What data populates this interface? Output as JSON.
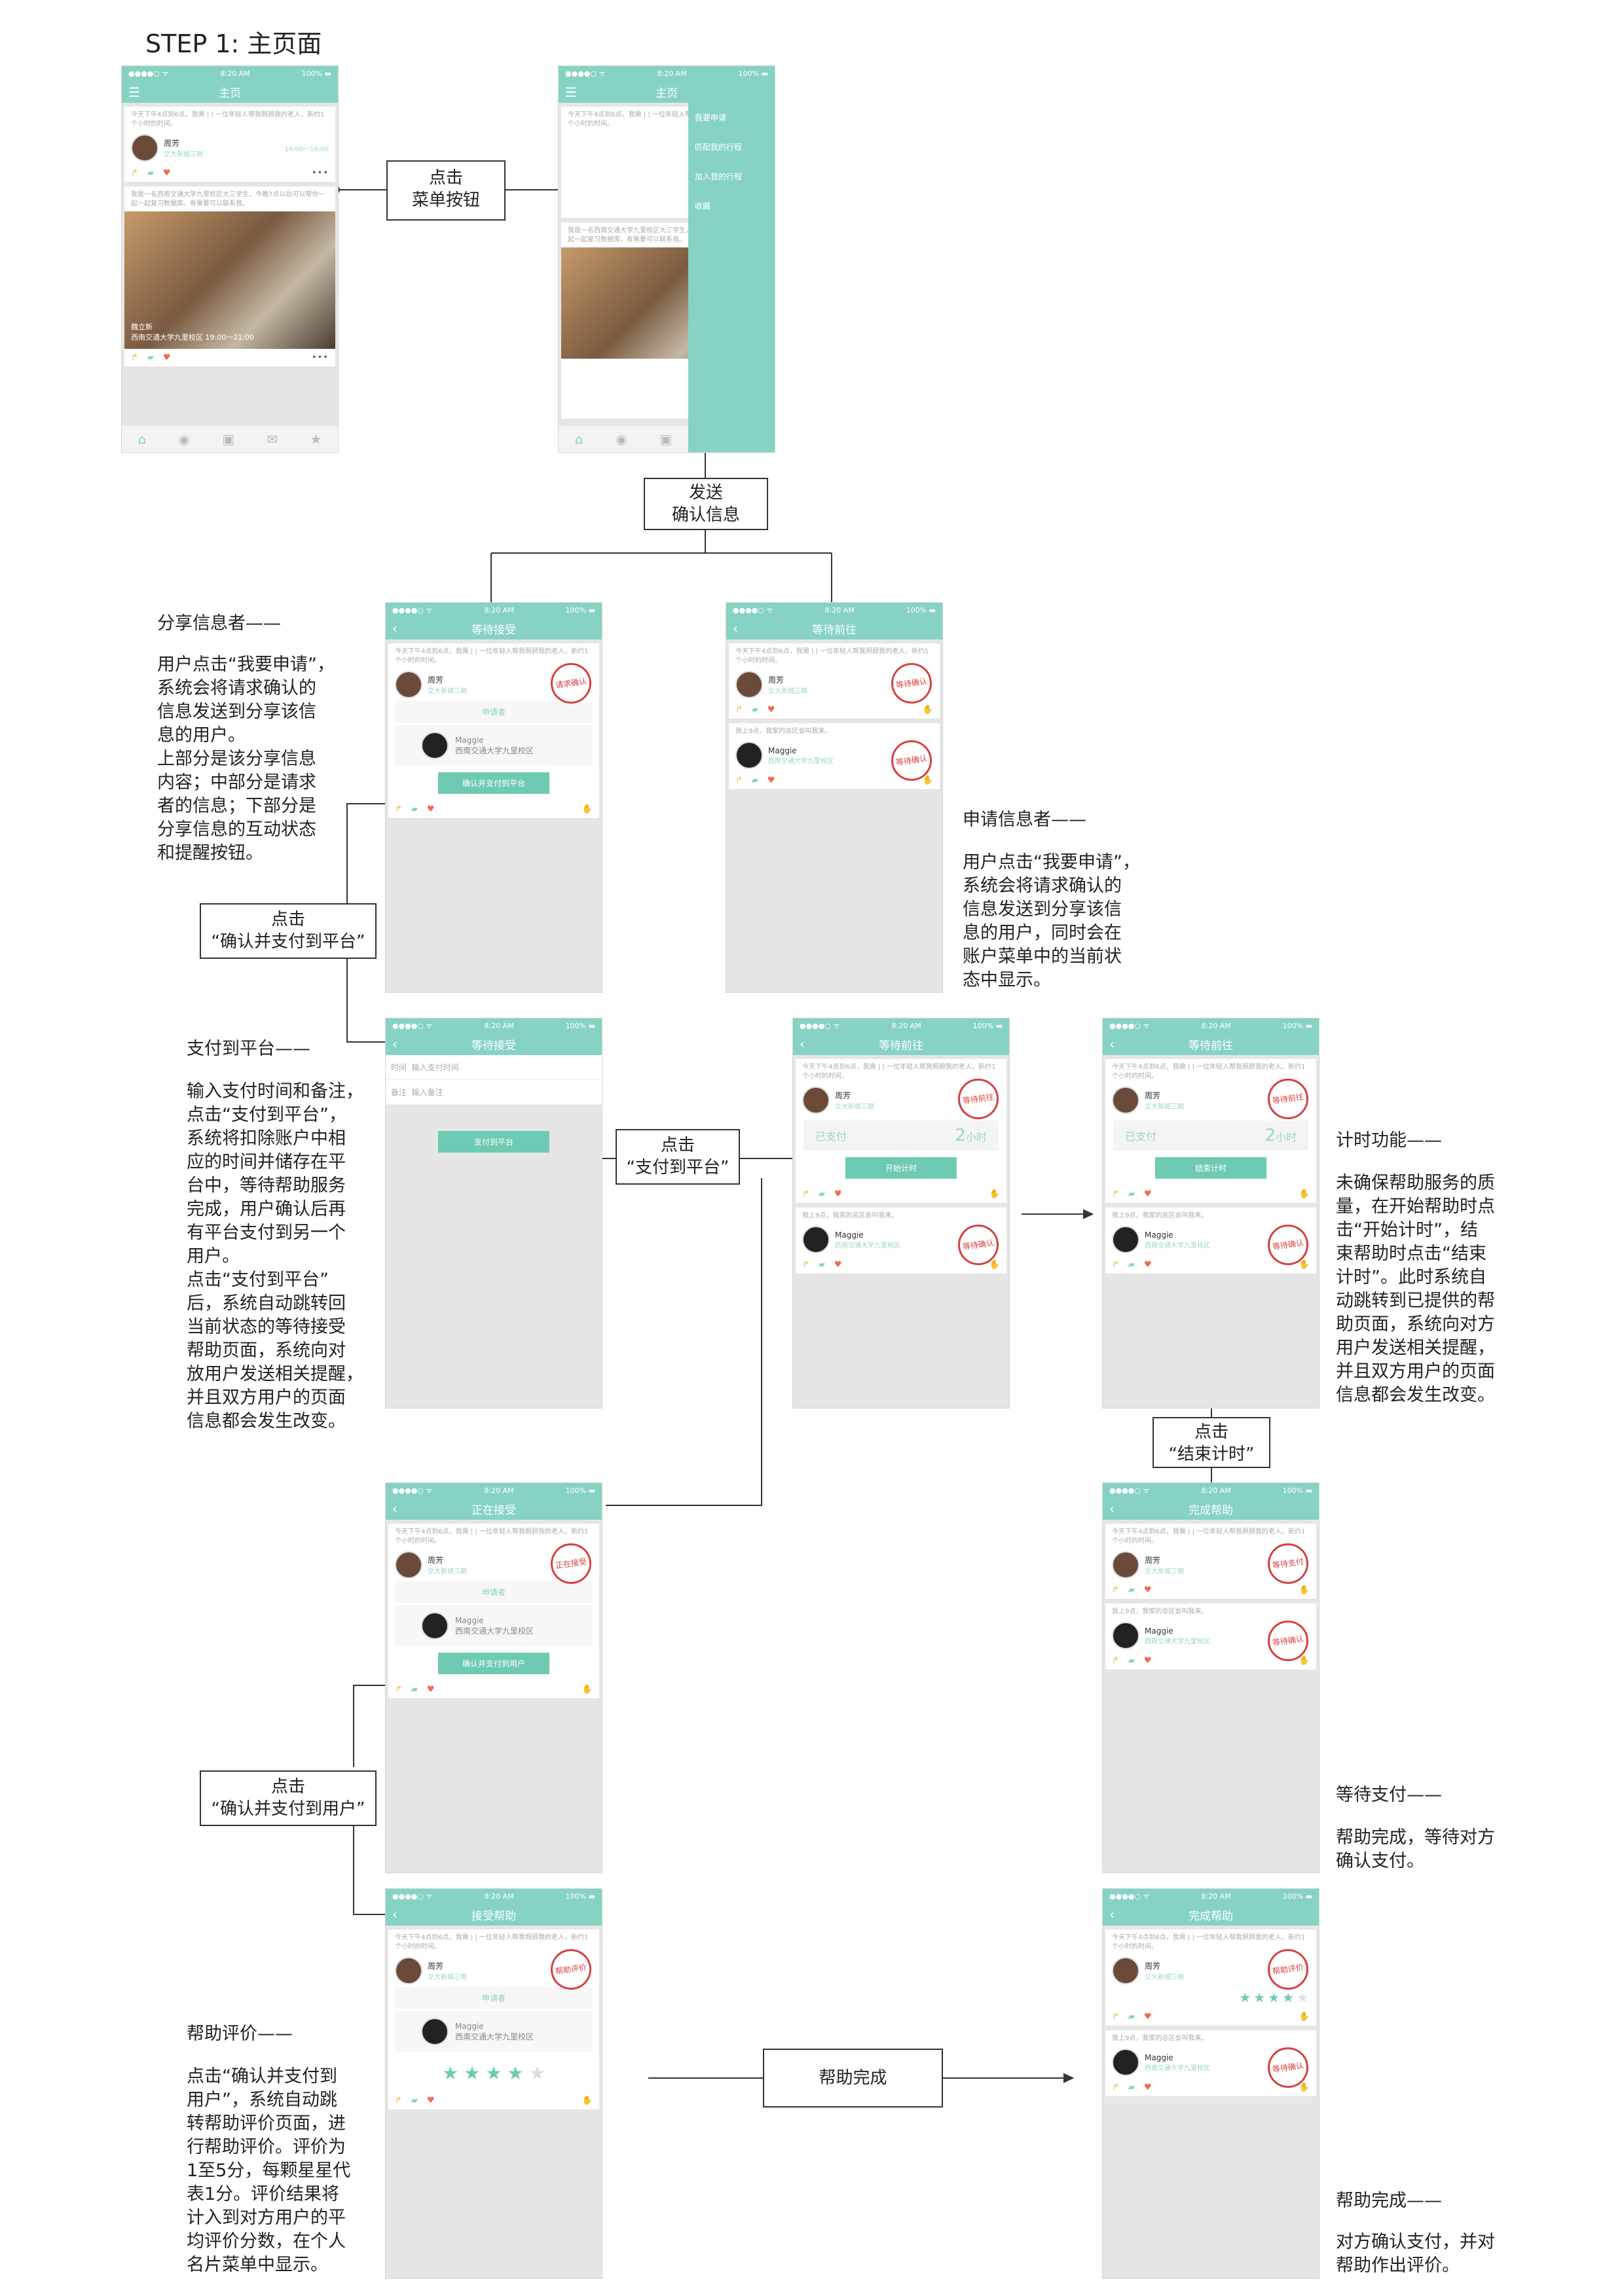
{
  "step_title": "STEP 1: 主页面",
  "status_bar": {
    "signal": "●●●●○ ᯤ",
    "time": "8:20 AM",
    "battery": "100% ▬"
  },
  "home_screen": {
    "nav_title": "主页",
    "post1_text": "今天下午4点到6点，我需 | | 一位年轻人帮我照顾我的老人，新约1个小时的时间。",
    "post1_user": "周芳",
    "post1_loc": "交大新城三期",
    "post1_time": "14:00一16:00",
    "post2_text": "我是一名西南交通大学九里校区大三学生，今晚7点以后可以帮你一起一起复习数据库。有需要可以联系我。",
    "post2_user": "魏立新",
    "post2_loc": "西南交通大学九里校区",
    "post2_time": "19:00一21:00",
    "counts": [
      "4",
      "2",
      "7",
      "2",
      "2",
      "6"
    ]
  },
  "menu_screen": {
    "nav_title": "主页",
    "menu_items": [
      "我要申请",
      "匹配我的行程",
      "加入我的行程",
      "收藏"
    ]
  },
  "screens": {
    "wait_accept": "等待接受",
    "wait_go": "等待前往",
    "accepting": "正在接受",
    "accept_help": "接受帮助",
    "finish_help": "完成帮助"
  },
  "labels": {
    "applicant": "申请者",
    "maggie": "Maggie",
    "maggie_loc": "西南交通大学九里校区",
    "reply_text": "我上9点，我家的总区会叫我来。",
    "btn_pay_platform_confirm": "确认并支付到平台",
    "btn_pay_platform": "支付到平台",
    "btn_start_timer": "开始计时",
    "btn_end_timer": "结束计时",
    "btn_pay_user": "确认并支付到用户",
    "form_time": "时间",
    "form_time_ph": "输入支付时间",
    "form_note": "备注",
    "form_note_ph": "输入备注",
    "paid": "已支付",
    "paid_num": "2",
    "paid_unit": "小时",
    "stamp_request": "请求确认",
    "stamp_wait_confirm": "等待确认",
    "stamp_wait_go": "等待前往",
    "stamp_accepting": "正在接受",
    "stamp_wait_pay": "等待支付",
    "stamp_help_eval": "帮助评价"
  },
  "flow_boxes": {
    "click_menu": "点击\n菜单按钮",
    "send_confirm": "发送\n确认信息",
    "click_confirm_platform": "点击\n“确认并支付到平台”",
    "click_pay_platform": "点击\n“支付到平台”",
    "click_end_timer": "点击\n“结束计时”",
    "click_confirm_user": "点击\n“确认并支付到用户”",
    "help_done": "帮助完成"
  },
  "notes": {
    "sharer_title": "分享信息者——",
    "sharer_body": "用户点击“我要申请”，\n系统会将请求确认的\n信息发送到分享该信\n息的用户。\n上部分是该分享信息\n内容；中部分是请求\n者的信息；下部分是\n分享信息的互动状态\n和提醒按钮。",
    "applicant_title": "申请信息者——",
    "applicant_body": "用户点击“我要申请”，\n系统会将请求确认的\n信息发送到分享该信\n息的用户，同时会在\n账户菜单中的当前状\n态中显示。",
    "pay_title": "支付到平台——",
    "pay_body": "输入支付时间和备注，\n点击“支付到平台”，\n系统将扣除账户中相\n应的时间并储存在平\n台中，等待帮助服务\n完成，用户确认后再\n有平台支付到另一个\n用户。\n点击“支付到平台”\n后，系统自动跳转回\n当前状态的等待接受\n帮助页面，系统向对\n放用户发送相关提醒，\n并且双方用户的页面\n信息都会发生改变。",
    "timer_title": "计时功能——",
    "timer_body": "未确保帮助服务的质\n量，在开始帮助时点\n击“开始计时”，结\n束帮助时点击“结束\n计时”。此时系统自\n动跳转到已提供的帮\n助页面，系统向对方\n用户发送相关提醒，\n并且双方用户的页面\n信息都会发生改变。",
    "wait_pay_title": "等待支付——",
    "wait_pay_body": "帮助完成，等待对方\n确认支付。",
    "eval_title": "帮助评价——",
    "eval_body": "点击“确认并支付到\n用户”，系统自动跳\n转帮助评价页面，进\n行帮助评价。评价为\n1至5分，每颗星星代\n表1分。评价结果将\n计入到对方用户的平\n均评价分数，在个人\n名片菜单中显示。",
    "done_title": "帮助完成——",
    "done_body": "对方确认支付，并对\n帮助作出评价。"
  },
  "icons": {
    "share": "share-icon",
    "comment": "comment-icon",
    "heart": "heart-icon",
    "more": "more-icon",
    "hand": "hand-icon",
    "home": "home-icon",
    "star": "star-icon",
    "back": "back-icon",
    "menu": "menu-icon"
  },
  "colors": {
    "accent": "#86d3c3",
    "button": "#6fcab3",
    "stamp": "#d64040",
    "heart": "#ef6b4a",
    "share": "#f2b74a"
  }
}
